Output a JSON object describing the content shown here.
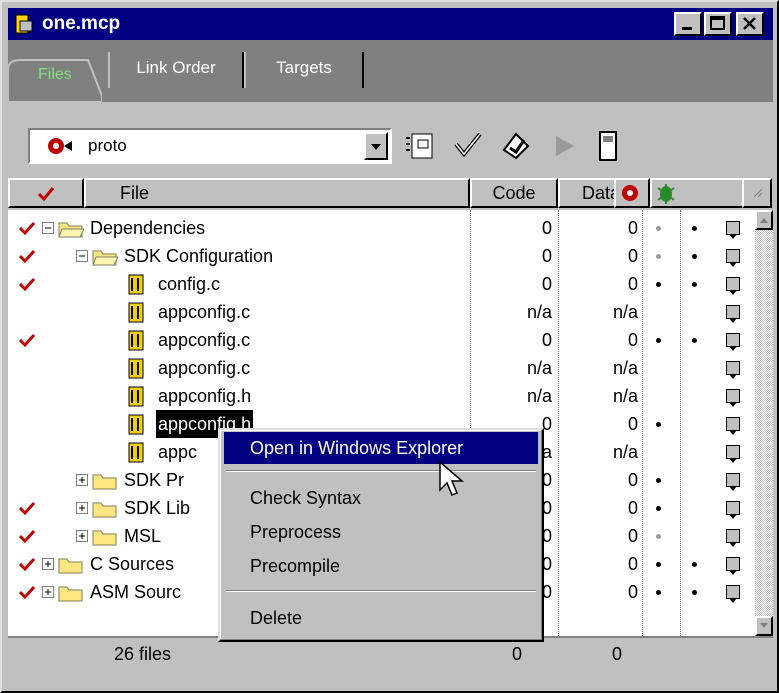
{
  "window": {
    "title": "one.mcp"
  },
  "tabs": {
    "files": "Files",
    "link_order": "Link Order",
    "targets": "Targets"
  },
  "toolbar": {
    "target": "proto"
  },
  "columns": {
    "file": "File",
    "code": "Code",
    "data": "Data"
  },
  "rows": [
    {
      "name": "Dependencies",
      "code": "0",
      "data": "0",
      "check": true,
      "dot1": "grey",
      "dot2": "black",
      "kind": "folder-open",
      "level": 0,
      "exp": "-"
    },
    {
      "name": "SDK Configuration",
      "code": "0",
      "data": "0",
      "check": true,
      "dot1": "grey",
      "dot2": "black",
      "kind": "folder-open",
      "level": 1,
      "exp": "-"
    },
    {
      "name": "config.c",
      "code": "0",
      "data": "0",
      "check": true,
      "dot1": "black",
      "dot2": "black",
      "kind": "file",
      "level": 2
    },
    {
      "name": "appconfig.c",
      "code": "n/a",
      "data": "n/a",
      "check": false,
      "dot1": "",
      "dot2": "",
      "kind": "file",
      "level": 2
    },
    {
      "name": "appconfig.c",
      "code": "0",
      "data": "0",
      "check": true,
      "dot1": "black",
      "dot2": "black",
      "kind": "file",
      "level": 2
    },
    {
      "name": "appconfig.c",
      "code": "n/a",
      "data": "n/a",
      "check": false,
      "dot1": "",
      "dot2": "",
      "kind": "file",
      "level": 2
    },
    {
      "name": "appconfig.h",
      "code": "n/a",
      "data": "n/a",
      "check": false,
      "dot1": "",
      "dot2": "",
      "kind": "file",
      "level": 2
    },
    {
      "name": "appconfig.h",
      "code": "0",
      "data": "0",
      "check": false,
      "dot1": "black",
      "dot2": "",
      "kind": "file",
      "level": 2,
      "selected": true
    },
    {
      "name": "appc",
      "code": "n/a",
      "data": "n/a",
      "check": false,
      "dot1": "",
      "dot2": "",
      "kind": "file",
      "level": 2
    },
    {
      "name": "SDK Pr",
      "code": "0",
      "data": "0",
      "check": false,
      "dot1": "black",
      "dot2": "",
      "kind": "folder",
      "level": 1,
      "exp": "+"
    },
    {
      "name": "SDK Lib",
      "code": "0",
      "data": "0",
      "check": true,
      "dot1": "black",
      "dot2": "",
      "kind": "folder",
      "level": 1,
      "exp": "+"
    },
    {
      "name": "MSL",
      "code": "0",
      "data": "0",
      "check": true,
      "dot1": "grey",
      "dot2": "",
      "kind": "folder",
      "level": 1,
      "exp": "+"
    },
    {
      "name": "C Sources",
      "code": "0",
      "data": "0",
      "check": true,
      "dot1": "black",
      "dot2": "black",
      "kind": "folder",
      "level": 0,
      "exp": "+"
    },
    {
      "name": "ASM Sourc",
      "code": "0",
      "data": "0",
      "check": true,
      "dot1": "black",
      "dot2": "black",
      "kind": "folder",
      "level": 0,
      "exp": "+"
    }
  ],
  "status": {
    "files": "26 files",
    "code": "0",
    "data": "0"
  },
  "menu": {
    "open_explorer": "Open in Windows Explorer",
    "check_syntax": "Check Syntax",
    "preprocess": "Preprocess",
    "precompile": "Precompile",
    "delete": "Delete"
  },
  "colors": {
    "title_bg": "#000080",
    "check_red": "#c00000",
    "folder": "#ffe680",
    "file_icon": "#f0d000"
  }
}
